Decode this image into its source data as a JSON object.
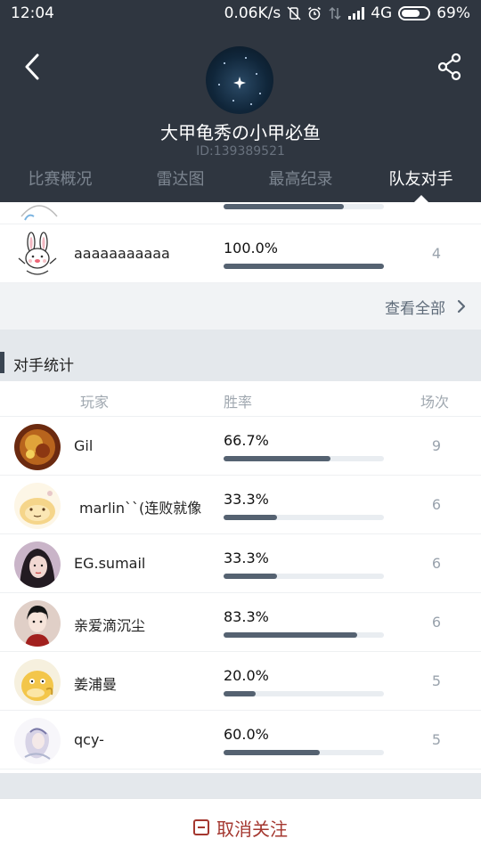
{
  "status_bar": {
    "time": "12:04",
    "network_speed": "0.06K/s",
    "network_type": "4G",
    "battery": "69%"
  },
  "profile": {
    "name": "大甲龟秀の小甲必鱼",
    "id": "ID:139389521"
  },
  "tabs": [
    {
      "label": "比赛概况",
      "active": false
    },
    {
      "label": "雷达图",
      "active": false
    },
    {
      "label": "最高纪录",
      "active": false
    },
    {
      "label": "队友对手",
      "active": true
    }
  ],
  "teammates": {
    "partial_row_fill": 0.75,
    "rows": [
      {
        "name": "aaaaaaaaaaa",
        "rate": "100.0%",
        "fill": 1.0,
        "count": "4"
      }
    ],
    "view_all": "查看全部"
  },
  "opponents": {
    "section_title": "对手统计",
    "col_player": "玩家",
    "col_rate": "胜率",
    "col_count": "场次",
    "rows": [
      {
        "name": "Gil",
        "rate": "66.7%",
        "fill": 0.667,
        "count": "9"
      },
      {
        "name": "marlin``(连败就像",
        "rate": "33.3%",
        "fill": 0.333,
        "count": "6"
      },
      {
        "name": "EG.sumail",
        "rate": "33.3%",
        "fill": 0.333,
        "count": "6"
      },
      {
        "name": "亲爱滴沉尘",
        "rate": "83.3%",
        "fill": 0.833,
        "count": "6"
      },
      {
        "name": "姜浦曼",
        "rate": "20.0%",
        "fill": 0.2,
        "count": "5"
      },
      {
        "name": "qcy-",
        "rate": "60.0%",
        "fill": 0.6,
        "count": "5"
      }
    ]
  },
  "footer": {
    "unfollow_label": "取消关注"
  },
  "colors": {
    "header_bg": "#2f3640",
    "bar_fill": "#556271",
    "unfollow": "#a4372f"
  }
}
